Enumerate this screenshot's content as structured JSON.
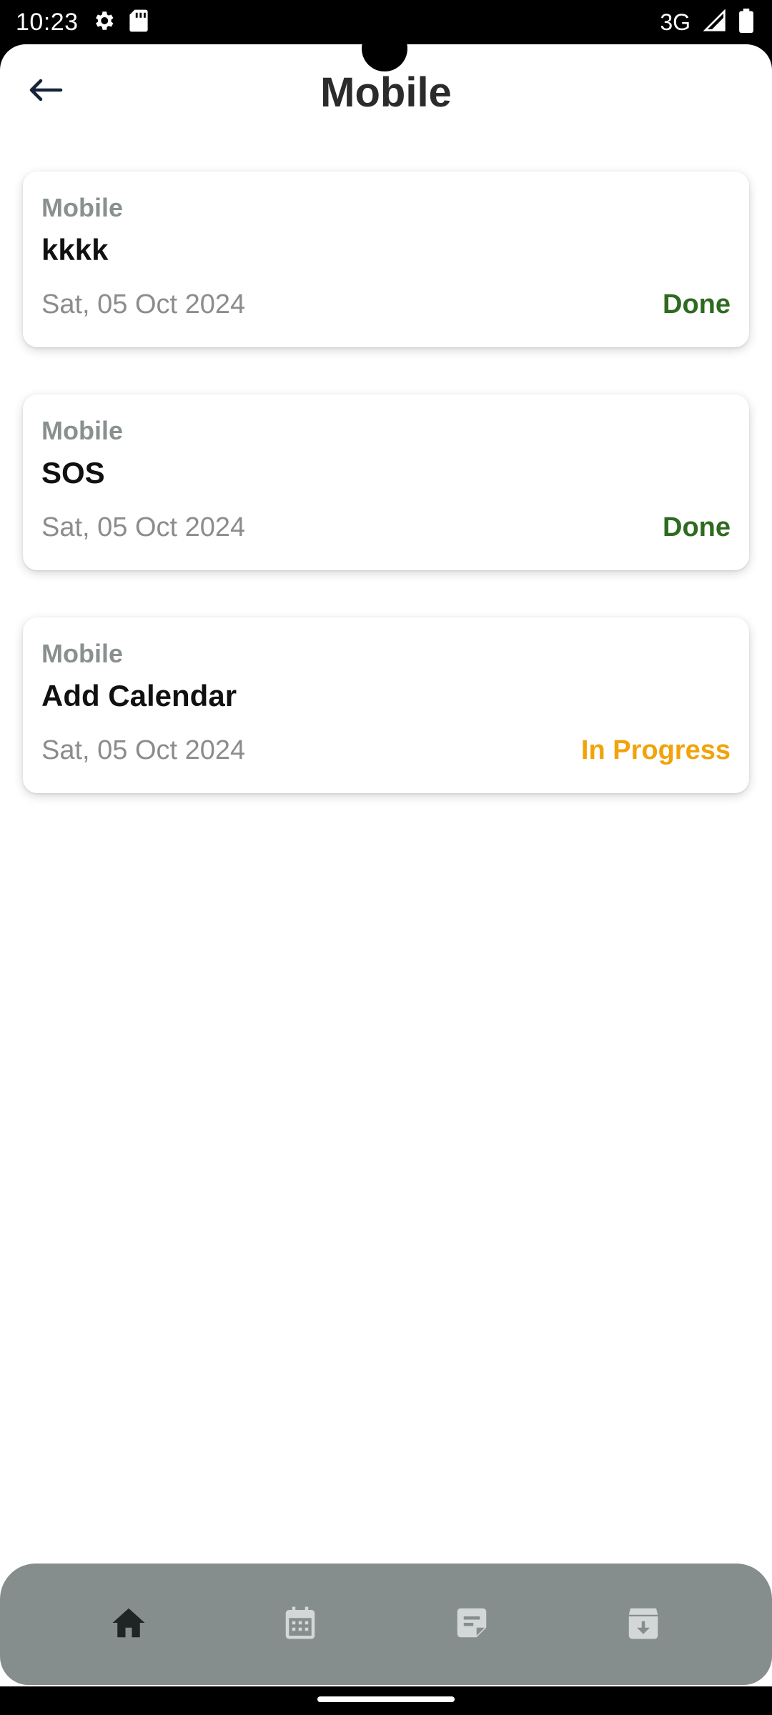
{
  "status_bar": {
    "time": "10:23",
    "network": "3G",
    "icons": [
      "settings-icon",
      "sd-card-icon",
      "signal-icon",
      "battery-icon"
    ]
  },
  "header": {
    "title": "Mobile",
    "back_icon": "arrow-left-icon"
  },
  "cards": [
    {
      "category": "Mobile",
      "title": "kkkk",
      "date": "Sat, 05 Oct 2024",
      "status": "Done"
    },
    {
      "category": "Mobile",
      "title": "SOS",
      "date": "Sat, 05 Oct 2024",
      "status": "Done"
    },
    {
      "category": "Mobile",
      "title": "Add Calendar",
      "date": "Sat, 05 Oct 2024",
      "status": "In Progress"
    }
  ],
  "status_colors": {
    "Done": "#2e6a1f",
    "In Progress": "#f0a30a"
  },
  "bottom_nav": {
    "items": [
      {
        "icon": "home-icon",
        "active": true
      },
      {
        "icon": "calendar-icon",
        "active": false
      },
      {
        "icon": "note-icon",
        "active": false
      },
      {
        "icon": "archive-icon",
        "active": false
      }
    ],
    "active_color": "#1f2424",
    "inactive_color": "#d3d7d7"
  }
}
